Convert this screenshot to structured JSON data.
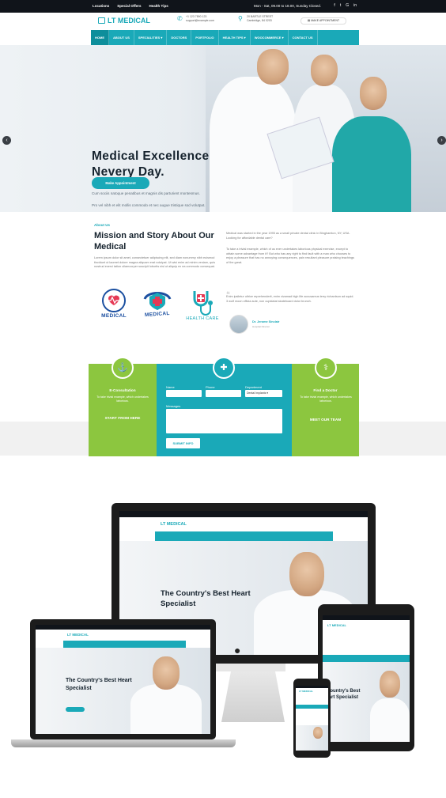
{
  "topbar": {
    "links": [
      "Locations",
      "Special Offers",
      "Health Tips"
    ],
    "hours": "Mon - Sat, 09.00 to 18.00, Sunday Closed.",
    "social": [
      "f",
      "t",
      "G",
      "in"
    ]
  },
  "header": {
    "logo": "LT MEDICAL",
    "phone": "+1 123 7890 123",
    "email": "support@example.com",
    "address1": "20 BARTLE STREET",
    "address2": "Cambridge, 84 0203",
    "appointment": "MAKE APPOINTMENT"
  },
  "nav": [
    "HOME",
    "ABOUT US",
    "SPECIALITIES ▾",
    "DOCTORS",
    "PORTFOLIO",
    "HEALTH TIPS ▾",
    "WOOCOMMERCE ▾",
    "CONTACT US"
  ],
  "hero": {
    "title": "Medical Excellence\nNevery Day.",
    "line1": "Cum sociis natoque penatibus et magnis dis parturient montesmus.",
    "line2": "Pro vel nibh et elit mollis commodo et nec augue tristique sod volutpat.",
    "button": "Make Appointment"
  },
  "about": {
    "label": "About Us",
    "title": "Mission and Story About Our Medical",
    "left": "Lorem ipsum dolor sit amet, consectetuer adipiscing elit, sed diam nonummy nibh euismod tincidunt ut laoreet dolore magna aliquam erat volutpat. Ut wisi enim ad minim veniam, quis nostrud exerci tation ullamcorper suscipit lobortis nisl ut aliquip ex ea commodo consequat.",
    "right1": "Medical was started in the year 1995 as a small private dental clinic in Binghamton, NY, USA. Looking for affordable dental care?",
    "right2": "To take a trivial example, which of us ever undertakes laborious physical exercise, except to obtain some advantage from it? But who has any right to find fault with a man who chooses to enjoy a pleasure that has no annoying consequences, pain resultant pleasure praising teachings of the great.",
    "right3": "Enim ipsiletur ultrice reprehenderit, enim vivamad high life accusamus terry richardson ad squid. 3 wolf moon officia aute, non cupidatat skateboard dolor brunch.",
    "author": "Dr. Jerome Sinclair",
    "role": "Hospital Director"
  },
  "logos": [
    {
      "label": "MEDICAL"
    },
    {
      "label": "MEDICAL"
    },
    {
      "label": "HEALTH CARE"
    }
  ],
  "boxes": {
    "left": {
      "title": "E-Consultation",
      "text": "To take trivial example, which undertakes laborious.",
      "link": "START FROM HERE"
    },
    "right": {
      "title": "Find a Doctor",
      "text": "To take trivial example, which undertakes laborious.",
      "link": "MEET OUR TEAM"
    },
    "form": {
      "name": "Name",
      "phone": "Phone",
      "dept": "Department",
      "dept_value": "Dental Implants ▾",
      "messages": "Messages",
      "submit": "SUBMIT INFO"
    }
  },
  "mockup": {
    "title": "The Country's Best Heart Specialist",
    "logo": "LT MEDICAL",
    "tablet_title": "e Country's Best Heart Specialist"
  },
  "colors": {
    "teal": "#1aa9b8",
    "green": "#8cc63f",
    "dark": "#10141a"
  }
}
